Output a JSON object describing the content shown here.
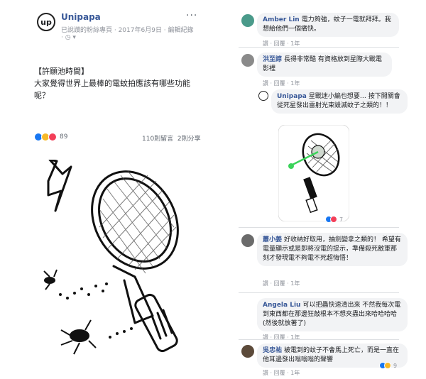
{
  "post": {
    "avatar_text": "up",
    "page_name": "Unipapa",
    "meta": "已說讚的粉絲專頁 · 2017年6月9日 · 編輯紀錄",
    "meta2": "· ◷ ▾",
    "more": "···",
    "tag": "【許願池時間】",
    "text": "大家覺得世界上最棒的電蚊拍應該有哪些功能呢？",
    "reaction_count": "89",
    "comments_count": "110則留言",
    "shares_count": "2則分享"
  },
  "comments": [
    {
      "name": "Amber Lin",
      "text": "電力夠強，蚊子一電就拜拜。我想給他們一個痛快。",
      "actions": "讚 · 回覆 · 1年"
    },
    {
      "name": "洪至諄",
      "text": "長得非常酷 有資格放到星際大戰電影裡",
      "actions": "讚 · 回覆 · 1年"
    },
    {
      "name": "Unipapa",
      "text": "星戰迷小編也想要… 按下開關會從死星發出雷射光束毀滅蚊子之類的！！",
      "reaction_count": "7"
    },
    {
      "name": "蕭小姜",
      "text": "好收納好取用，抽劍變拿之類的！ 希望有電量顯示或是即將沒電的提示，準備殺死敵軍那刻才發現電不夠電不死超悔悟！",
      "actions": "讚 · 回覆 · 1年"
    },
    {
      "name": "Angela Liu",
      "text": "可以把蟲快速清出來 不然我每次電到東西都在那邊狂敲根本不想夾蟲出來哈哈哈哈(然後就放著了)",
      "actions": "讚 · 回覆 · 1年"
    },
    {
      "name": "吳忠祐",
      "text": "被電到的蚊子不會馬上死亡，而是一直在他耳邊發出嗡嗡嗡的聲響",
      "actions": "讚 · 回覆 · 1年",
      "reaction_count": "9"
    }
  ],
  "colors": {
    "link": "#385898",
    "bubble": "#f2f3f5",
    "like": "#1877f2",
    "haha": "#f7b928",
    "love": "#f33e58"
  }
}
